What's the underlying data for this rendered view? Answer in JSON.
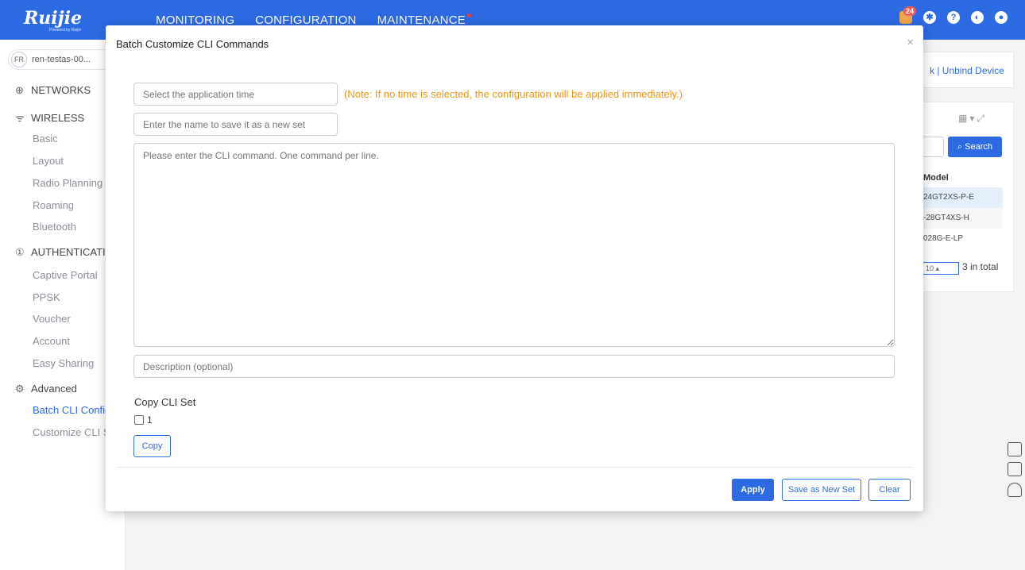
{
  "app": {
    "logo": "Ruijie",
    "logo_sub": "Powered by Ruijie"
  },
  "nav": {
    "items": [
      "MONITORING",
      "CONFIGURATION",
      "MAINTENANCE"
    ],
    "notification_count": "24"
  },
  "sidebar": {
    "tenant_avatar": "FR",
    "tenant_name": "ren-testas-00...",
    "sections": {
      "networks": "NETWORKS",
      "wireless": "WIRELESS",
      "authentication": "AUTHENTICATIO",
      "advanced": "Advanced"
    },
    "wireless_items": [
      "Basic",
      "Layout",
      "Radio Planning",
      "Roaming",
      "Bluetooth"
    ],
    "auth_items": [
      "Captive Portal",
      "PPSK",
      "Voucher",
      "Account",
      "Easy Sharing"
    ],
    "advanced_items": [
      "Batch CLI Config",
      "Customize CLI Se"
    ]
  },
  "background": {
    "unbind": "k | Unbind Device",
    "search_label": "Search",
    "col_model": "Model",
    "rows": [
      "24GT2XS-P-E",
      "-28GT4XS-H",
      "028G-E-LP"
    ],
    "page_size": "10",
    "total": "3 in total"
  },
  "modal": {
    "title": "Batch Customize CLI Commands",
    "time_placeholder": "Select the application time",
    "note": "(Note: If no time is selected, the configuration will be applied immediately.)",
    "name_placeholder": "Enter the name to save it as a new set",
    "cli_placeholder": "Please enter the CLI command. One command per line.",
    "desc_placeholder": "Description (optional)",
    "copy_title": "Copy CLI Set",
    "copy_option": "1",
    "copy_button": "Copy",
    "apply_button": "Apply",
    "save_button": "Save as New Set",
    "clear_button": "Clear"
  },
  "colors": {
    "brand": "#2d6be4",
    "note": "#f0960f"
  }
}
